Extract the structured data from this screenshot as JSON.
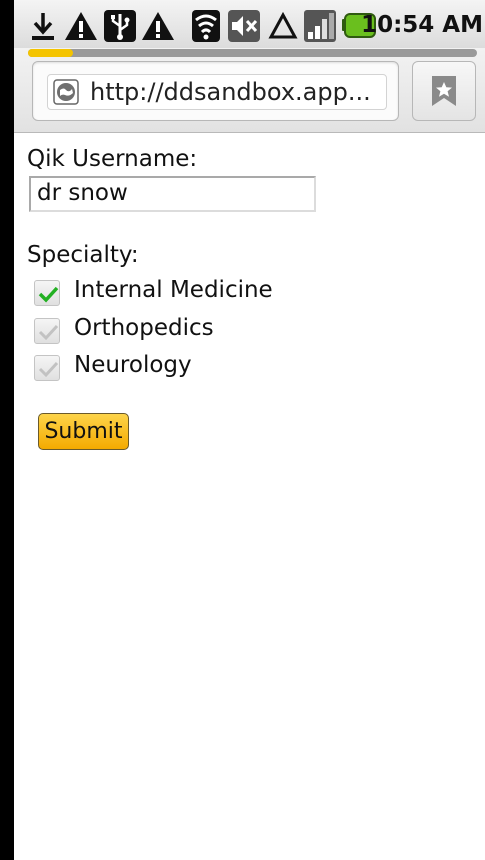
{
  "status_bar": {
    "time": "10:54 AM",
    "icons": [
      "download-icon",
      "warning-icon",
      "usb-icon",
      "warning-icon",
      "wifi-icon",
      "muted-speaker-icon",
      "triangle-icon",
      "signal-icon",
      "battery-icon"
    ],
    "battery_color": "#6abf1e"
  },
  "browser": {
    "url": "http://ddsandbox.app...",
    "page_load_progress": 0.1,
    "progress_color": "#f4c400"
  },
  "form": {
    "username_label": "Qik Username:",
    "username_value": "dr snow",
    "specialty_label": "Specialty:",
    "specialties": [
      {
        "label": "Internal Medicine",
        "checked": true
      },
      {
        "label": "Orthopedics",
        "checked": true
      },
      {
        "label": "Neurology",
        "checked": true
      }
    ],
    "submit_label": "Submit",
    "submit_color": "#f7b500"
  }
}
